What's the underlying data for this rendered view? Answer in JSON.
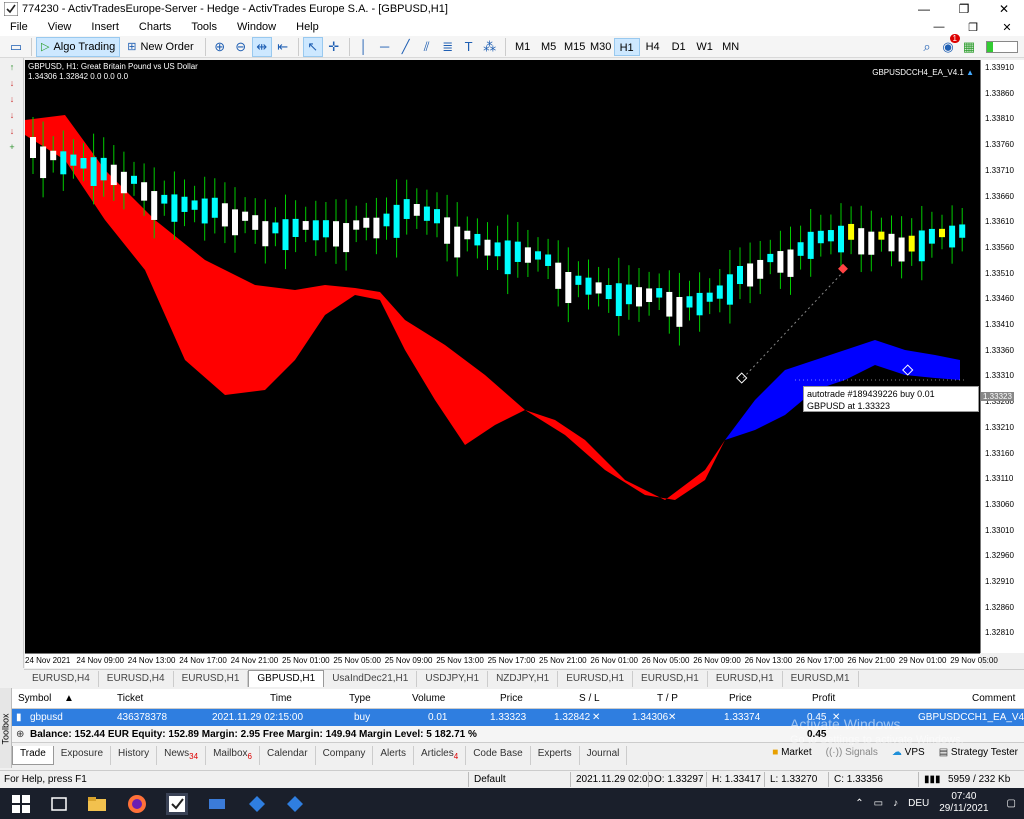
{
  "window": {
    "title": "774230 - ActivTradesEurope-Server - Hedge - ActivTrades Europe S.A. - [GBPUSD,H1]",
    "controls": [
      "—",
      "❐",
      "✕"
    ]
  },
  "menu": [
    "File",
    "View",
    "Insert",
    "Charts",
    "Tools",
    "Window",
    "Help"
  ],
  "toolbar": {
    "algo_trading": "Algo Trading",
    "new_order": "New Order",
    "timeframes": [
      "M1",
      "M5",
      "M15",
      "M30",
      "H1",
      "H4",
      "D1",
      "W1",
      "MN"
    ],
    "active_timeframe": "H1",
    "notifications": "1"
  },
  "chart": {
    "header_line1": "GBPUSD, H1:  Great Britain Pound vs US Dollar",
    "header_line2": "1.34306  1.32842  0.0  0.0  0.0",
    "ea_label": "GBPUSDCCH4_EA_V4.1",
    "tooltip_line1": "autotrade #189439226 buy 0.01 GBPUSD at 1.33323",
    "tooltip_line2": "1.33312",
    "y_ticks": [
      "1.33910",
      "1.33860",
      "1.33810",
      "1.33760",
      "1.33710",
      "1.33660",
      "1.33610",
      "1.33560",
      "1.33510",
      "1.33460",
      "1.33410",
      "1.33360",
      "1.33310",
      "1.33260",
      "1.33210",
      "1.33160",
      "1.33110",
      "1.33060",
      "1.33010",
      "1.32960",
      "1.32910",
      "1.32860",
      "1.32810"
    ],
    "current_price": "1.33323",
    "x_ticks": [
      "24 Nov 2021",
      "24 Nov 09:00",
      "24 Nov 13:00",
      "24 Nov 17:00",
      "24 Nov 21:00",
      "25 Nov 01:00",
      "25 Nov 05:00",
      "25 Nov 09:00",
      "25 Nov 13:00",
      "25 Nov 17:00",
      "25 Nov 21:00",
      "26 Nov 01:00",
      "26 Nov 05:00",
      "26 Nov 09:00",
      "26 Nov 13:00",
      "26 Nov 17:00",
      "26 Nov 21:00",
      "29 Nov 01:00",
      "29 Nov 05:00"
    ]
  },
  "chart_tabs": [
    "EURUSD,H4",
    "EURUSD,H4",
    "EURUSD,H1",
    "GBPUSD,H1",
    "UsaIndDec21,H1",
    "USDJPY,H1",
    "NZDJPY,H1",
    "EURUSD,H1",
    "EURUSD,H1",
    "EURUSD,H1",
    "EURUSD,M1"
  ],
  "active_chart_tab": "GBPUSD,H1",
  "trade_table": {
    "headers": [
      "Symbol",
      "Ticket",
      "Time",
      "Type",
      "Volume",
      "Price",
      "S / L",
      "T / P",
      "Price",
      "Profit",
      "Comment"
    ],
    "row": {
      "symbol": "gbpusd",
      "ticket": "436378378",
      "time": "2021.11.29 02:15:00",
      "type": "buy",
      "volume": "0.01",
      "price": "1.33323",
      "sl": "1.32842",
      "tp": "1.34306",
      "current": "1.33374",
      "profit": "0.45",
      "comment": "GBPUSDCCH1_EA_V401"
    },
    "balance_line": "Balance: 152.44 EUR  Equity: 152.89  Margin: 2.95  Free Margin: 149.94  Margin Level: 5 182.71 %",
    "balance_profit": "0.45"
  },
  "toolbox_label": "Toolbox",
  "bottom_tabs": [
    {
      "label": "Trade",
      "badge": ""
    },
    {
      "label": "Exposure",
      "badge": ""
    },
    {
      "label": "History",
      "badge": ""
    },
    {
      "label": "News",
      "badge": "34"
    },
    {
      "label": "Mailbox",
      "badge": "6"
    },
    {
      "label": "Calendar",
      "badge": ""
    },
    {
      "label": "Company",
      "badge": ""
    },
    {
      "label": "Alerts",
      "badge": ""
    },
    {
      "label": "Articles",
      "badge": "4"
    },
    {
      "label": "Code Base",
      "badge": ""
    },
    {
      "label": "Experts",
      "badge": ""
    },
    {
      "label": "Journal",
      "badge": ""
    }
  ],
  "bottom_right": {
    "market": "Market",
    "signals": "Signals",
    "vps": "VPS",
    "tester": "Strategy Tester"
  },
  "watermark": {
    "title": "Activate Windows",
    "sub": "Go to Settings to activate Windows."
  },
  "status": {
    "help": "For Help, press F1",
    "profile": "Default",
    "time": "2021.11.29 02:00",
    "open": "O: 1.33297",
    "high": "H: 1.33417",
    "low": "L: 1.33270",
    "close": "C: 1.33356",
    "traffic": "5959 / 232 Kb"
  },
  "taskbar": {
    "lang": "DEU",
    "time": "07:40",
    "date": "29/11/2021"
  },
  "colors": {
    "bull": "#ffffff",
    "bear": "#00ffff",
    "wick": "#00cc00",
    "cloud_down": "#ff0000",
    "cloud_up": "#0000ff",
    "highlight": "#ffff00",
    "selection": "#2f7ee0"
  }
}
